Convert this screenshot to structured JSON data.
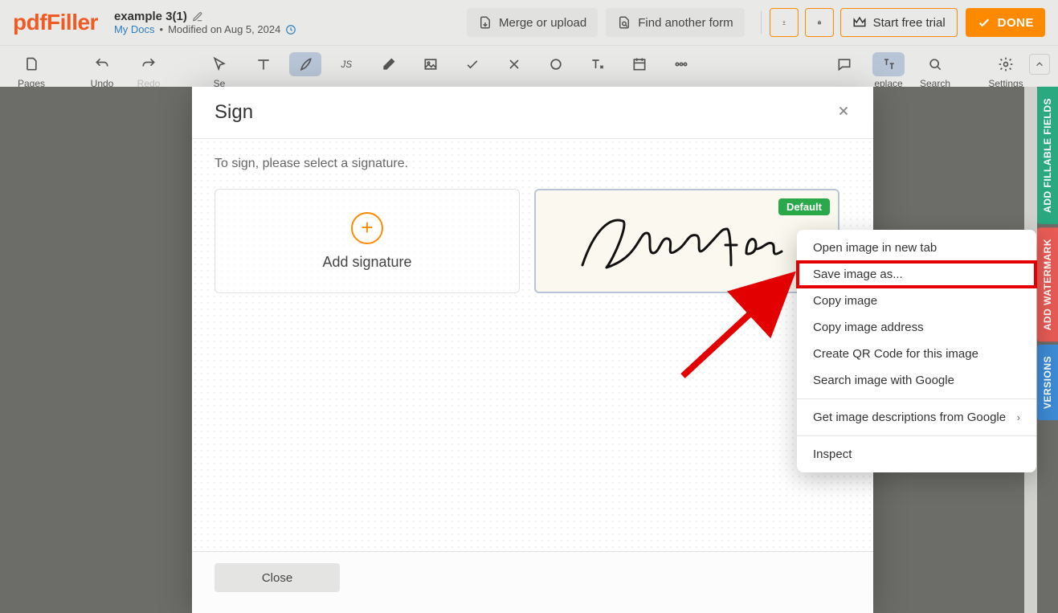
{
  "header": {
    "logo": "pdfFiller",
    "doc_title": "example 3(1)",
    "my_docs": "My Docs",
    "modified": "Modified on Aug 5, 2024",
    "merge": "Merge or upload",
    "find_form": "Find another form",
    "start_trial": "Start free trial",
    "done": "DONE"
  },
  "toolbar": {
    "pages": "Pages",
    "undo": "Undo",
    "redo": "Redo",
    "select": "Se",
    "replace": "eplace",
    "search": "Search",
    "settings": "Settings"
  },
  "modal": {
    "title": "Sign",
    "instruction": "To sign, please select a signature.",
    "add_signature": "Add signature",
    "badge": "Default",
    "signature_text": "Ravellin",
    "close": "Close"
  },
  "context_menu": {
    "items": [
      "Open image in new tab",
      "Save image as...",
      "Copy image",
      "Copy image address",
      "Create QR Code for this image",
      "Search image with Google"
    ],
    "desc_item": "Get image descriptions from Google",
    "inspect": "Inspect"
  },
  "side_tabs": {
    "fillable": "ADD FILLABLE FIELDS",
    "watermark": "ADD WATERMARK",
    "versions": "VERSIONS"
  }
}
